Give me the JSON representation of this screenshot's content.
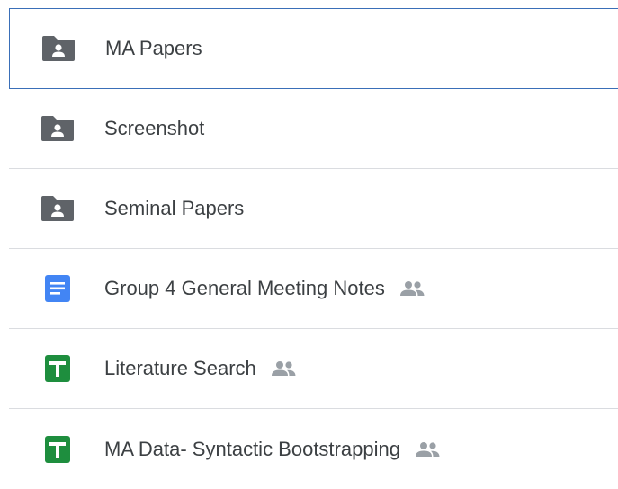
{
  "files": [
    {
      "name": "MA Papers",
      "type": "folder",
      "icon": "shared-folder-icon",
      "shared": false,
      "selected": true
    },
    {
      "name": "Screenshot",
      "type": "folder",
      "icon": "shared-folder-icon",
      "shared": false,
      "selected": false
    },
    {
      "name": "Seminal Papers",
      "type": "folder",
      "icon": "shared-folder-icon",
      "shared": false,
      "selected": false
    },
    {
      "name": "Group 4 General Meeting Notes",
      "type": "doc",
      "icon": "google-docs-icon",
      "shared": true,
      "selected": false
    },
    {
      "name": "Literature Search",
      "type": "sheet",
      "icon": "google-sheets-icon",
      "shared": true,
      "selected": false
    },
    {
      "name": "MA Data- Syntactic Bootstrapping",
      "type": "sheet",
      "icon": "google-sheets-icon",
      "shared": true,
      "selected": false
    }
  ],
  "colors": {
    "folder": "#5f6368",
    "docs": "#4285f4",
    "sheets": "#1e8e3e",
    "shared": "#9aa0a6",
    "text": "#3c4043",
    "selection_border": "#3a6fb8",
    "divider": "#dadce0"
  }
}
